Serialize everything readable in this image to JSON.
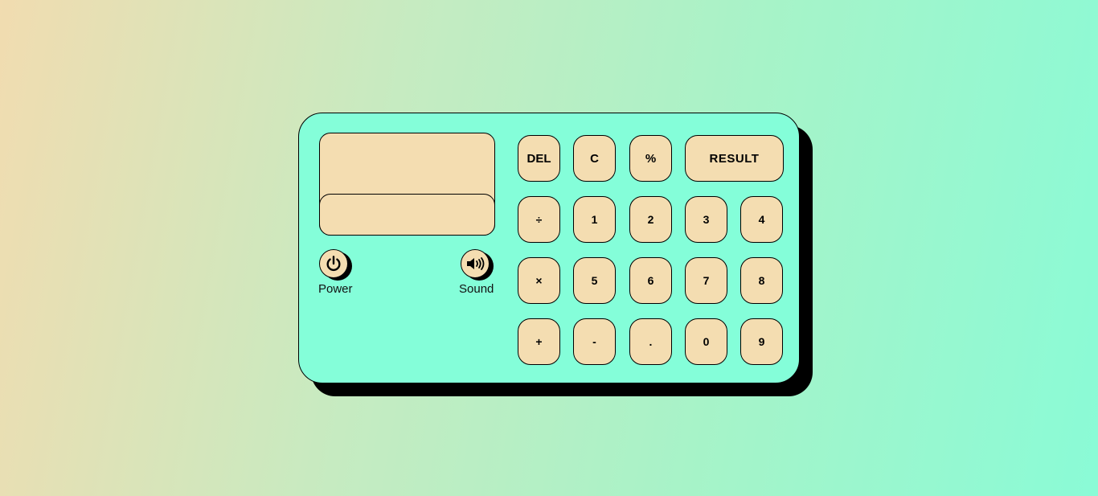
{
  "calculator": {
    "display": {
      "expression": "",
      "result": ""
    },
    "power": {
      "label": "Power",
      "icon": "power-icon"
    },
    "sound": {
      "label": "Sound",
      "icon": "speaker-icon"
    },
    "keys": {
      "del": "DEL",
      "clear": "C",
      "percent": "%",
      "result": "RESULT",
      "divide": "÷",
      "one": "1",
      "two": "2",
      "three": "3",
      "four": "4",
      "multiply": "×",
      "five": "5",
      "six": "6",
      "seven": "7",
      "eight": "8",
      "plus": "+",
      "minus": "-",
      "dot": ".",
      "zero": "0",
      "nine": "9"
    },
    "colors": {
      "body": "#84fed9",
      "keys": "#f4ddb1",
      "shadow": "#000000"
    }
  }
}
